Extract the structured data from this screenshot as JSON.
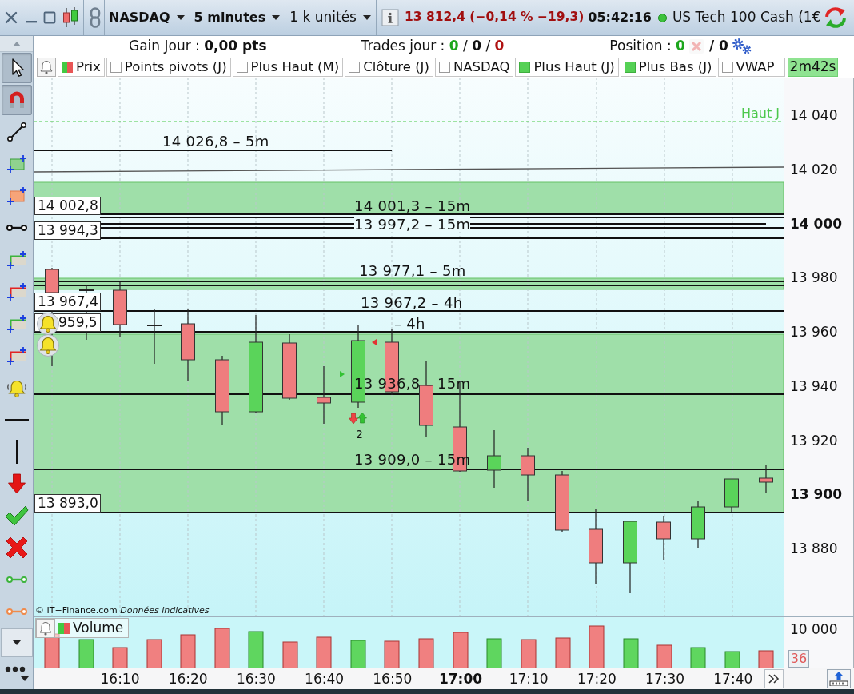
{
  "toolbar": {
    "symbol": "NASDAQ",
    "period": "5 minutes",
    "quantity": "1 k unités",
    "quote": "13 812,4 (−0,14 % −19,3)",
    "time": "05:42:16",
    "instrument": "US Tech 100 Cash (1€"
  },
  "summary": {
    "gain": "Gain Jour : **0,00 pts**",
    "trades": {
      "label": "Trades jour :",
      "parts": [
        {
          "text": "0",
          "kind": "win"
        },
        {
          "text": "/",
          "kind": "separator"
        },
        {
          "text": "0",
          "kind": "neutral"
        },
        {
          "text": "/",
          "kind": "separator"
        },
        {
          "text": "0",
          "kind": "loss"
        }
      ]
    },
    "position": {
      "label": "Position :",
      "open": "0",
      "close_disabled": true,
      "total": "/ 0"
    }
  },
  "tools": [
    {
      "kind": "pointer",
      "selected": true
    },
    {
      "kind": "magnet",
      "selected": true
    },
    {
      "kind": "trendline",
      "selected": false
    },
    {
      "kind": "buyzone",
      "selected": false
    },
    {
      "kind": "sellzone",
      "selected": false
    },
    {
      "kind": "measure",
      "selected": false
    },
    {
      "kind": "buyorder",
      "selected": false
    },
    {
      "kind": "sellorder",
      "selected": false
    },
    {
      "kind": "buystop",
      "selected": false
    },
    {
      "kind": "sellstop",
      "selected": false
    },
    {
      "kind": "alert",
      "selected": false
    },
    {
      "kind": "hline",
      "selected": false
    },
    {
      "kind": "vline",
      "selected": false
    },
    {
      "kind": "sell",
      "selected": false
    },
    {
      "kind": "validate",
      "selected": false
    },
    {
      "kind": "cancel",
      "selected": false
    },
    {
      "kind": "greenline",
      "selected": false
    },
    {
      "kind": "orangeline",
      "selected": false
    }
  ],
  "legend": [
    {
      "label": "Prix",
      "kind": "series"
    },
    {
      "label": "Points pivots (J)",
      "kind": "indicator",
      "checked": false
    },
    {
      "label": "Plus Haut (M)",
      "kind": "indicator",
      "checked": false
    },
    {
      "label": "Clôture (J)",
      "kind": "indicator",
      "checked": false
    },
    {
      "label": "NASDAQ",
      "kind": "indicator",
      "checked": false
    },
    {
      "label": "Plus Haut (J)",
      "kind": "indicator",
      "checked": true
    },
    {
      "label": "Plus Bas (J)",
      "kind": "indicator",
      "checked": true
    },
    {
      "label": "VWAP",
      "kind": "indicator",
      "checked": false
    }
  ],
  "timer": "2m42s",
  "chart": {
    "high_label": "Haut J",
    "levels": [
      "14 026,8 – 5m",
      "14 001,3 – 15m",
      "13 997,2 – 15m",
      "13 977,1 – 5m",
      "13 967,2 – 4h",
      "– 4h",
      "13 936,8 – 15m",
      "13 909,0 – 15m"
    ],
    "price_tags": [
      "14 002,8",
      "13 994,3",
      "13 967,4",
      "959,5",
      "13 893,0"
    ],
    "signal_count": "2",
    "copyright": "© IT−Finance.com *Données indicatives*"
  },
  "price_axis": [
    {
      "text": "14 040",
      "kind": "minor"
    },
    {
      "text": "14 020",
      "kind": "minor"
    },
    {
      "text": "14 000",
      "kind": "major"
    },
    {
      "text": "13 980",
      "kind": "minor"
    },
    {
      "text": "13 960",
      "kind": "minor"
    },
    {
      "text": "13 940",
      "kind": "minor"
    },
    {
      "text": "13 920",
      "kind": "minor"
    },
    {
      "text": "13 900",
      "kind": "major"
    },
    {
      "text": "13 880",
      "kind": "minor"
    }
  ],
  "volume": {
    "label": "Volume",
    "axis_label": "10 000",
    "count": "36"
  },
  "time_axis": [
    {
      "text": "16:10",
      "kind": "minor"
    },
    {
      "text": "16:20",
      "kind": "minor"
    },
    {
      "text": "16:30",
      "kind": "minor"
    },
    {
      "text": "16:40",
      "kind": "minor"
    },
    {
      "text": "16:50",
      "kind": "minor"
    },
    {
      "text": "17:00",
      "kind": "major"
    },
    {
      "text": "17:10",
      "kind": "minor"
    },
    {
      "text": "17:20",
      "kind": "minor"
    },
    {
      "text": "17:30",
      "kind": "minor"
    },
    {
      "text": "17:40",
      "kind": "minor"
    }
  ]
}
